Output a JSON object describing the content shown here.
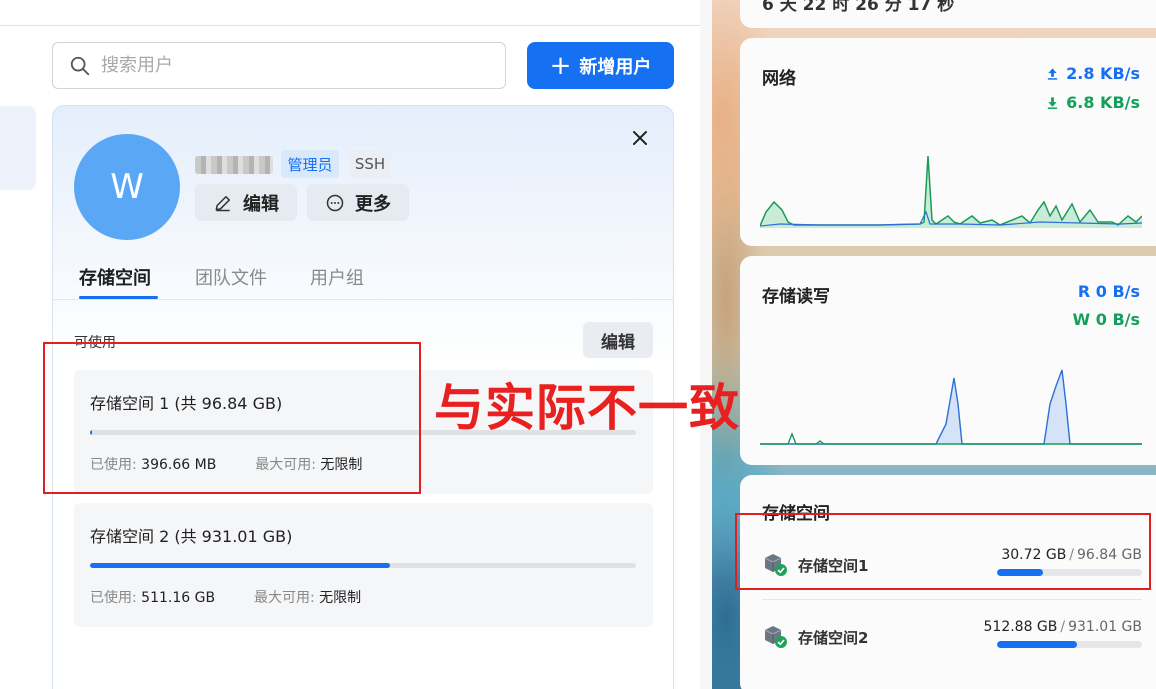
{
  "search": {
    "placeholder": "搜索用户"
  },
  "add_user": {
    "label": "新增用户"
  },
  "user": {
    "avatar_letter": "W",
    "badges": [
      "管理员",
      "SSH"
    ],
    "edit_label": "编辑",
    "more_label": "更多"
  },
  "tabs": [
    "存储空间",
    "团队文件",
    "用户组"
  ],
  "storage_section": {
    "available_label": "可使用",
    "edit_label": "编辑",
    "used_label": "已使用:",
    "max_label": "最大可用:",
    "spaces": [
      {
        "title": "存储空间 1 (共 96.84 GB)",
        "used": "396.66 MB",
        "max": "无限制",
        "fill_fraction": 0.004
      },
      {
        "title": "存储空间 2 (共 931.01 GB)",
        "used": "511.16 GB",
        "max": "无限制",
        "fill_fraction": 0.55
      }
    ]
  },
  "dashboard": {
    "uptime": "6 天 22 时 26 分 17 秒",
    "network": {
      "title": "网络",
      "upload": "2.8 KB/s",
      "download": "6.8 KB/s"
    },
    "io": {
      "title": "存储读写",
      "read": "R 0 B/s",
      "write": "W 0 B/s"
    },
    "storage": {
      "title": "存储空间",
      "items": [
        {
          "name": "存储空间1",
          "used": "30.72 GB",
          "total": "96.84 GB",
          "fill_fraction": 0.317
        },
        {
          "name": "存储空间2",
          "used": "512.88 GB",
          "total": "931.01 GB",
          "fill_fraction": 0.551
        }
      ]
    }
  },
  "annotation": {
    "text": "与实际不一致"
  },
  "colors": {
    "accent": "#1570f2",
    "download_green": "#14a05a",
    "annotation_red": "#e02020"
  },
  "icons": [
    "search-icon",
    "plus-icon",
    "close-icon",
    "pencil-icon",
    "more-circle-icon",
    "upload-arrow-icon",
    "download-arrow-icon",
    "disk-check-icon"
  ]
}
